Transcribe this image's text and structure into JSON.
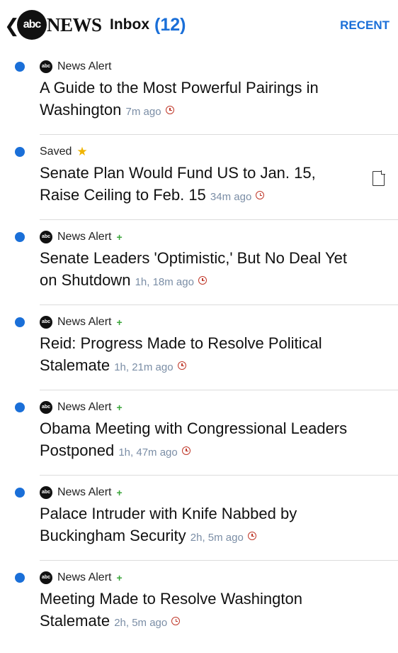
{
  "header": {
    "back_glyph": "❮",
    "logo_text": "abc",
    "brand_text": "NEWS",
    "inbox_label": "Inbox",
    "inbox_count": "(12)",
    "recent_label": "RECENT"
  },
  "colors": {
    "accent": "#1a6fd8",
    "unread_dot": "#1a6fd8",
    "time_text": "#7b8ea6",
    "clock_icon": "#c0392b",
    "plus": "#3aa53a",
    "star": "#f0b400"
  },
  "items": [
    {
      "source": "News Alert",
      "headline": "A Guide to the Most Powerful Pairings in Washington",
      "time": "7m ago",
      "icon": "abc-logo-icon",
      "plus": "",
      "star": "",
      "has_document": false
    },
    {
      "source": "Saved",
      "headline": "Senate Plan Would Fund US to Jan. 15, Raise Ceiling to Feb. 15",
      "time": "34m ago",
      "icon": "",
      "plus": "",
      "star": "★",
      "has_document": true
    },
    {
      "source": "News Alert",
      "headline": "Senate Leaders 'Optimistic,' But No Deal Yet on Shutdown",
      "time": "1h, 18m ago",
      "icon": "abc-logo-icon",
      "plus": "+",
      "star": "",
      "has_document": false
    },
    {
      "source": "News Alert",
      "headline": "Reid: Progress Made to Resolve Political Stalemate",
      "time": "1h, 21m ago",
      "icon": "abc-logo-icon",
      "plus": "+",
      "star": "",
      "has_document": false
    },
    {
      "source": "News Alert",
      "headline": "Obama Meeting with Congressional Leaders Postponed",
      "time": "1h, 47m ago",
      "icon": "abc-logo-icon",
      "plus": "+",
      "star": "",
      "has_document": false
    },
    {
      "source": "News Alert",
      "headline": "Palace Intruder with Knife Nabbed by Buckingham Security",
      "time": "2h, 5m ago",
      "icon": "abc-logo-icon",
      "plus": "+",
      "star": "",
      "has_document": false
    },
    {
      "source": "News Alert",
      "headline": "Meeting Made to Resolve Washington Stalemate",
      "time": "2h, 5m ago",
      "icon": "abc-logo-icon",
      "plus": "+",
      "star": "",
      "has_document": false
    }
  ]
}
